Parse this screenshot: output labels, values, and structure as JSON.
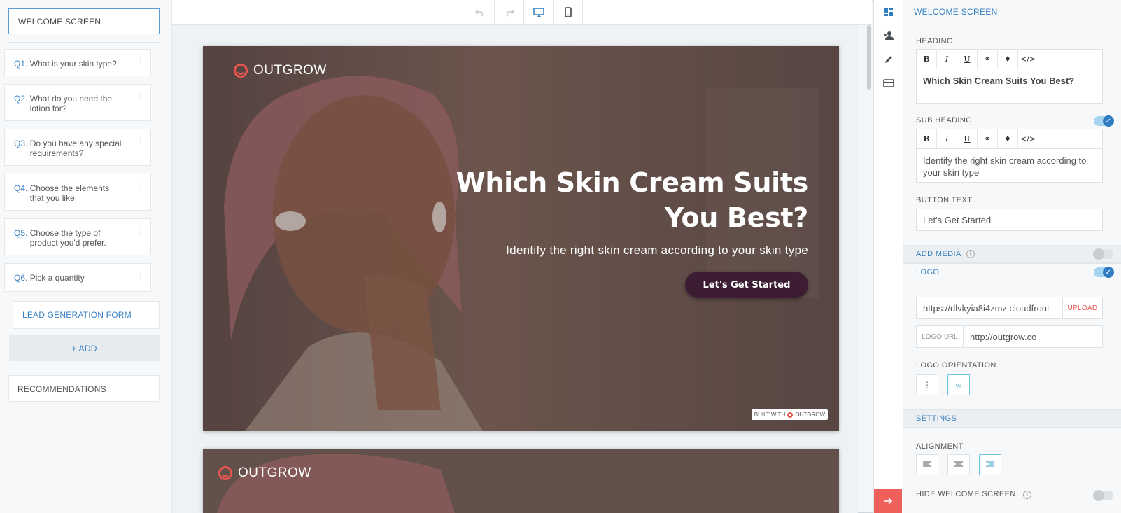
{
  "sidebar": {
    "welcome": "WELCOME SCREEN",
    "questions": [
      {
        "num": "Q1.",
        "text": "What is your skin type?"
      },
      {
        "num": "Q2.",
        "text": "What do you need the lotion for?"
      },
      {
        "num": "Q3.",
        "text": "Do you have any special requirements?"
      },
      {
        "num": "Q4.",
        "text": "Choose the elements that you like."
      },
      {
        "num": "Q5.",
        "text": "Choose the type of product you'd prefer."
      },
      {
        "num": "Q6.",
        "text": "Pick a quantity."
      }
    ],
    "lead_form": "LEAD GENERATION FORM",
    "add": "+ ADD",
    "recommendations": "RECOMMENDATIONS"
  },
  "toolbar": {
    "icons": [
      "undo-icon",
      "redo-icon",
      "desktop-icon",
      "mobile-icon"
    ],
    "active": "desktop-icon"
  },
  "preview": {
    "logo_text": "OUTGROW",
    "title": "Which Skin Cream Suits You Best?",
    "subtitle": "Identify the right skin cream according to your skin type",
    "button": "Let's Get Started",
    "built_with": "BUILT WITH",
    "built_brand": "OUTGROW"
  },
  "icon_strip": [
    "dashboard-icon",
    "add-user-icon",
    "pencil-icon",
    "card-icon",
    "arrow-right-icon"
  ],
  "panel": {
    "title": "WELCOME SCREEN",
    "heading_label": "HEADING",
    "heading_value": "Which Skin Cream Suits You Best?",
    "sub_heading_label": "SUB HEADING",
    "sub_heading_value": "Identify the right skin cream according to your skin type",
    "button_text_label": "BUTTON TEXT",
    "button_text_value": "Let's Get Started",
    "add_media": "ADD MEDIA",
    "logo": "LOGO",
    "logo_src": "https://dlvkyia8i4zmz.cloudfront",
    "upload": "UPLOAD",
    "logo_url_label": "LOGO URL",
    "logo_url_value": "http://outgrow.co",
    "logo_orientation": "LOGO ORIENTATION",
    "settings": "SETTINGS",
    "alignment": "ALIGNMENT",
    "hide_welcome": "HIDE WELCOME SCREEN",
    "toggles": {
      "sub_heading": true,
      "add_media": false,
      "logo": true,
      "hide_welcome": false
    },
    "editor_tools": [
      "B",
      "I",
      "U",
      "link",
      "color",
      "code"
    ]
  },
  "colors": {
    "accent": "#3a82c4",
    "brand": "#e8564f",
    "cta": "#3c1d33"
  }
}
